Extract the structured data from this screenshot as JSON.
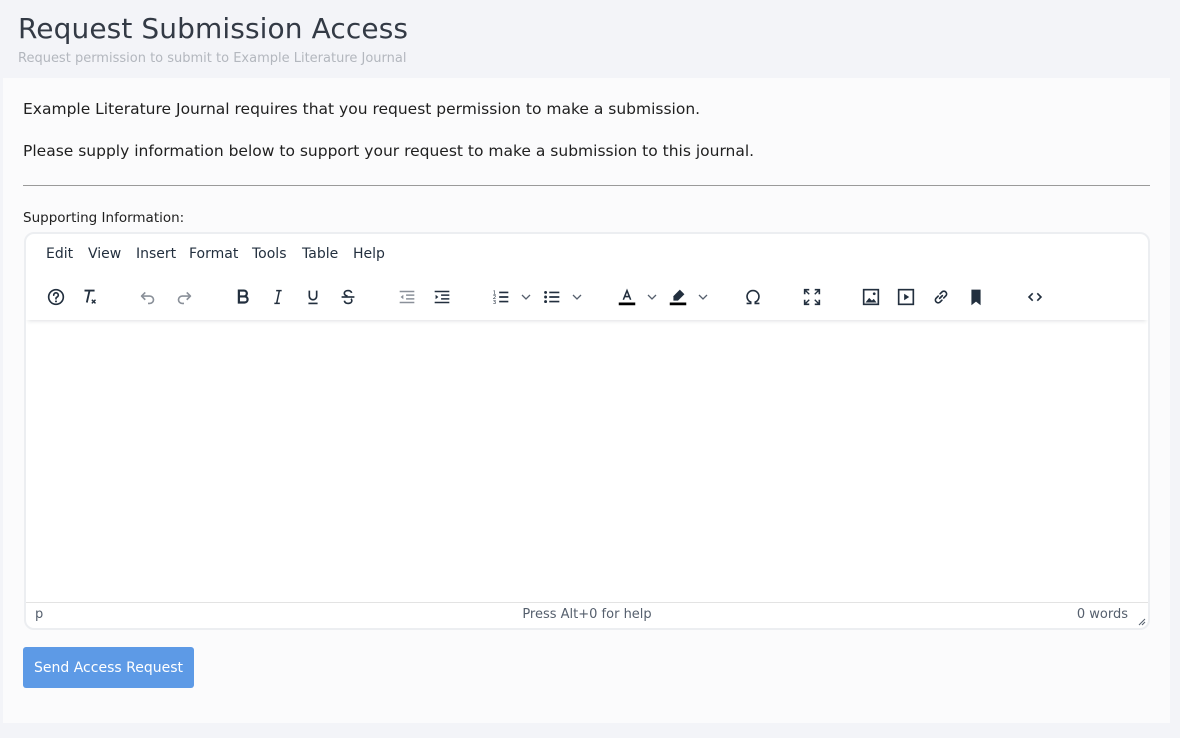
{
  "header": {
    "title": "Request Submission Access",
    "subtitle": "Request permission to submit to Example Literature Journal"
  },
  "intro": {
    "line1": "Example Literature Journal requires that you request permission to make a submission.",
    "line2": "Please supply information below to support your request to make a submission to this journal."
  },
  "field": {
    "label": "Supporting Information:"
  },
  "editor": {
    "menu": [
      "Edit",
      "View",
      "Insert",
      "Format",
      "Tools",
      "Table",
      "Help"
    ],
    "toolbar_icons": [
      "help-icon",
      "clear-format-icon",
      "undo-icon",
      "redo-icon",
      "bold-icon",
      "italic-icon",
      "underline-icon",
      "strikethrough-icon",
      "outdent-icon",
      "indent-icon",
      "numbered-list-icon",
      "bullet-list-icon",
      "text-color-icon",
      "highlight-color-icon",
      "special-character-icon",
      "fullscreen-icon",
      "image-icon",
      "media-icon",
      "link-icon",
      "bookmark-icon",
      "source-code-icon"
    ],
    "status_path": "p",
    "status_help": "Press Alt+0 for help",
    "word_count": "0 words"
  },
  "actions": {
    "send_label": "Send Access Request"
  },
  "colors": {
    "accent": "#5d9ae6",
    "background": "#f3f4f8",
    "card": "#fbfbfc"
  }
}
